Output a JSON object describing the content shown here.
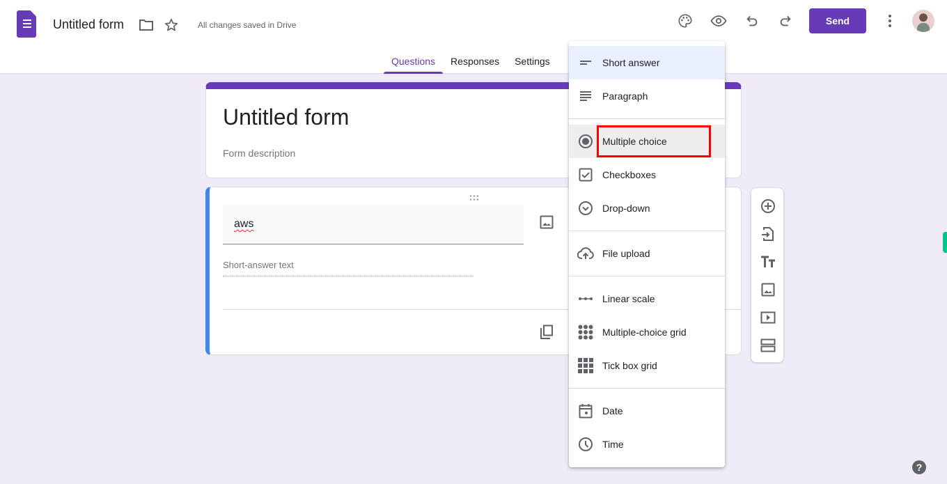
{
  "header": {
    "title": "Untitled form",
    "save_status": "All changes saved in Drive",
    "send_label": "Send",
    "icons": [
      "forms-logo-icon",
      "folder-icon",
      "star-icon",
      "palette-icon",
      "preview-eye-icon",
      "undo-icon",
      "redo-icon",
      "more-vert-icon",
      "avatar"
    ]
  },
  "tabs": [
    {
      "label": "Questions",
      "active": true
    },
    {
      "label": "Responses",
      "active": false
    },
    {
      "label": "Settings",
      "active": false
    }
  ],
  "form": {
    "title": "Untitled form",
    "description_placeholder": "Form description"
  },
  "question": {
    "title_value": "aws",
    "answer_hint": "Short-answer text"
  },
  "question_type_menu": {
    "groups": [
      [
        {
          "label": "Short answer",
          "icon": "short-answer-icon",
          "state": "selected"
        },
        {
          "label": "Paragraph",
          "icon": "paragraph-icon"
        }
      ],
      [
        {
          "label": "Multiple choice",
          "icon": "radio-button-icon",
          "state": "hovered",
          "annotated": true
        },
        {
          "label": "Checkboxes",
          "icon": "checkbox-icon"
        },
        {
          "label": "Drop-down",
          "icon": "dropdown-circle-icon"
        }
      ],
      [
        {
          "label": "File upload",
          "icon": "cloud-upload-icon"
        }
      ],
      [
        {
          "label": "Linear scale",
          "icon": "linear-scale-icon"
        },
        {
          "label": "Multiple-choice grid",
          "icon": "radio-grid-icon"
        },
        {
          "label": "Tick box grid",
          "icon": "checkbox-grid-icon"
        }
      ],
      [
        {
          "label": "Date",
          "icon": "calendar-icon"
        },
        {
          "label": "Time",
          "icon": "clock-icon"
        }
      ]
    ]
  },
  "side_toolbar": [
    "add-question-icon",
    "import-questions-icon",
    "add-title-icon",
    "add-image-icon",
    "add-video-icon",
    "add-section-icon"
  ],
  "colors": {
    "accent": "#673ab7",
    "question_active": "#4285f4",
    "background": "#f0ebf8",
    "annotation": "#ff0000"
  },
  "help_label": "?"
}
